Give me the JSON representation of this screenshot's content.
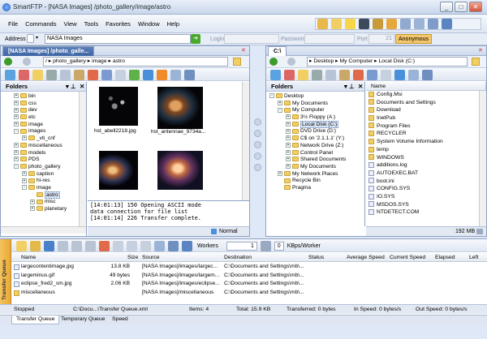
{
  "window": {
    "title": "SmartFTP - [NASA Images] /photo_gallery/image/astro"
  },
  "menu": [
    "File",
    "Commands",
    "View",
    "Tools",
    "Favorites",
    "Window",
    "Help"
  ],
  "address": {
    "label": "Address",
    "value": "NASA Images",
    "login_label": "Login",
    "password_label": "Password",
    "port_label": "Port",
    "port_value": "21",
    "anonymous": "Anonymous"
  },
  "left_pane": {
    "tab_label": "[NASA Images] /photo_galle...",
    "path": [
      "/",
      "photo_gallery",
      "image",
      "astro"
    ],
    "folders_title": "Folders",
    "tree": [
      {
        "label": "bin",
        "depth": 1,
        "expander": "+"
      },
      {
        "label": "css",
        "depth": 1,
        "expander": "+"
      },
      {
        "label": "dev",
        "depth": 1,
        "expander": "+"
      },
      {
        "label": "etc",
        "depth": 1,
        "expander": "+"
      },
      {
        "label": "image",
        "depth": 1,
        "expander": "+"
      },
      {
        "label": "images",
        "depth": 1,
        "expander": "-"
      },
      {
        "label": "_vti_cnf",
        "depth": 2,
        "expander": "+"
      },
      {
        "label": "miscellaneous",
        "depth": 1,
        "expander": "+"
      },
      {
        "label": "models",
        "depth": 1,
        "expander": "+"
      },
      {
        "label": "PDS",
        "depth": 1,
        "expander": "+"
      },
      {
        "label": "photo_gallery",
        "depth": 1,
        "expander": "-"
      },
      {
        "label": "caption",
        "depth": 2,
        "expander": "+"
      },
      {
        "label": "hi-res",
        "depth": 2,
        "expander": "+"
      },
      {
        "label": "image",
        "depth": 2,
        "expander": "-"
      },
      {
        "label": "astro",
        "depth": 3,
        "expander": "",
        "selected": true
      },
      {
        "label": "misc",
        "depth": 3,
        "expander": "+"
      },
      {
        "label": "planetary",
        "depth": 3,
        "expander": "+"
      }
    ],
    "thumbnails": [
      {
        "name": "hst_abell2218.jpg"
      },
      {
        "name": "hst_antennae_9734a..."
      },
      {
        "name": ""
      },
      {
        "name": ""
      }
    ],
    "log": [
      "[14:01:13] 150 Opening ASCII mode",
      "data connection for file list",
      "[14:01:14] 226 Transfer complete."
    ],
    "status": "Normal"
  },
  "right_pane": {
    "tab_label": "C:\\",
    "path": [
      "Desktop",
      "My Computer",
      "Local Disk (C:)"
    ],
    "folders_title": "Folders",
    "tree": [
      {
        "label": "Desktop",
        "depth": 0,
        "expander": "-"
      },
      {
        "label": "My Documents",
        "depth": 1,
        "expander": "+"
      },
      {
        "label": "My Computer",
        "depth": 1,
        "expander": "-"
      },
      {
        "label": "3½ Floppy (A:)",
        "depth": 2,
        "expander": "+"
      },
      {
        "label": "Local Disk (C:)",
        "depth": 2,
        "expander": "+",
        "selected": true
      },
      {
        "label": "DVD Drive (D:)",
        "depth": 2,
        "expander": "+"
      },
      {
        "label": "C$ on '2.1.1.1' (Y:)",
        "depth": 2,
        "expander": "+"
      },
      {
        "label": "Network Drive (Z:)",
        "depth": 2,
        "expander": "+"
      },
      {
        "label": "Control Panel",
        "depth": 2,
        "expander": "+"
      },
      {
        "label": "Shared Documents",
        "depth": 2,
        "expander": "+"
      },
      {
        "label": "My Documents",
        "depth": 2,
        "expander": "+"
      },
      {
        "label": "My Network Places",
        "depth": 1,
        "expander": "+"
      },
      {
        "label": "Recycle Bin",
        "depth": 1,
        "expander": ""
      },
      {
        "label": "Pragma",
        "depth": 1,
        "expander": ""
      }
    ],
    "name_header": "Name",
    "files": [
      "Config.Msi",
      "Documents and Settings",
      "Download",
      "InetPub",
      "Program Files",
      "RECYCLER",
      "System Volume Information",
      "temp",
      "WINDOWS",
      "additions.log",
      "AUTOEXEC.BAT",
      "boot.ini",
      "CONFIG.SYS",
      "IO.SYS",
      "MSDOS.SYS",
      "NTDETECT.COM"
    ],
    "status": "192 MB"
  },
  "queue": {
    "side_label": "Transfer Queue",
    "workers_label": "Workers",
    "workers_value": "1",
    "speed_label": "KBps/Worker",
    "speed_value": "0",
    "headers": [
      "Name",
      "Size",
      "Source",
      "Destination",
      "Status",
      "Average Speed",
      "Current Speed",
      "Elapsed",
      "Left"
    ],
    "rows": [
      {
        "name": "largecontentimage.jpg",
        "size": "13.8 KB",
        "source": "[NASA Images]/images/largec...",
        "dest": "C:\\Documents and Settings\\mb\\..."
      },
      {
        "name": "largeminus.gif",
        "size": "49 bytes",
        "source": "[NASA Images]/images/largem...",
        "dest": "C:\\Documents and Settings\\mb\\..."
      },
      {
        "name": "eclipse_fred2_sm.jpg",
        "size": "2.06 KB",
        "source": "[NASA Images]/images/eclipse...",
        "dest": "C:\\Documents and Settings\\mb\\..."
      },
      {
        "name": "miscellaneous",
        "size": "",
        "source": "[NASA Images]/miscellaneous",
        "dest": "C:\\Documents and Settings\\mb\\..."
      }
    ]
  },
  "statusbar": {
    "state": "Stopped",
    "file": "C:\\Docu...\\Transfer Queue.xml",
    "items": "Items: 4",
    "total": "Total: 15.9 KB",
    "transferred": "Transferred: 0 bytes",
    "in_speed": "In Speed: 0 bytes/s",
    "out_speed": "Out Speed: 0 bytes/s"
  },
  "bottom_tabs": [
    "Transfer Queue",
    "Temporary Queue",
    "Speed"
  ]
}
